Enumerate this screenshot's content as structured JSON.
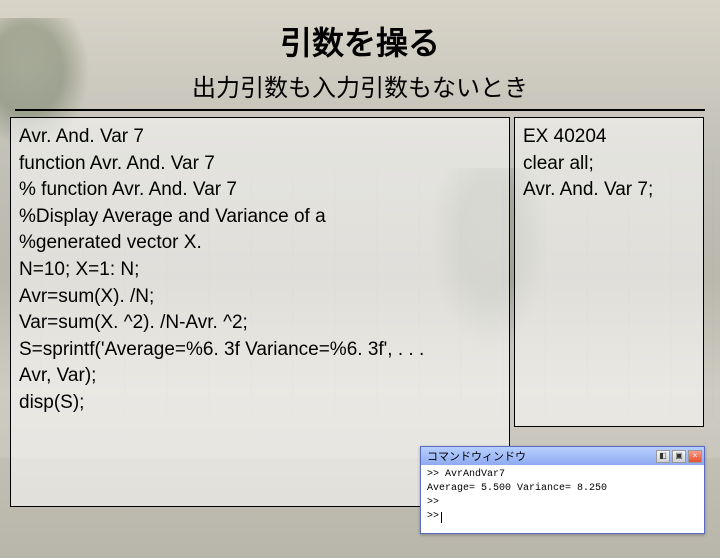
{
  "title": "引数を操る",
  "subtitle": "出力引数も入力引数もないとき",
  "left_panel": {
    "filename": "Avr. And. Var 7",
    "line1": "function Avr. And. Var 7",
    "line2": "% function Avr. And. Var 7",
    "line3": "%Display Average and Variance of a",
    "line4": "%generated vector X.",
    "line5": "N=10; X=1: N;",
    "line6": "Avr=sum(X). /N;",
    "line7": "Var=sum(X. ^2). /N-Avr. ^2;",
    "line8": "S=sprintf('Average=%6. 3f  Variance=%6. 3f', . . .",
    "line9": "Avr, Var);",
    "line10": "disp(S);"
  },
  "right_panel": {
    "filename": "EX 40204",
    "line1": "clear all;",
    "line2": "Avr. And. Var 7;"
  },
  "cmdwin": {
    "title": "コマンドウィンドウ",
    "btn_dock": "◧",
    "btn_undock": "▣",
    "btn_close": "×",
    "line1": ">> AvrAndVar7",
    "line2": "Average= 5.500  Variance= 8.250",
    "line3": ">>",
    "line4": ">>"
  }
}
